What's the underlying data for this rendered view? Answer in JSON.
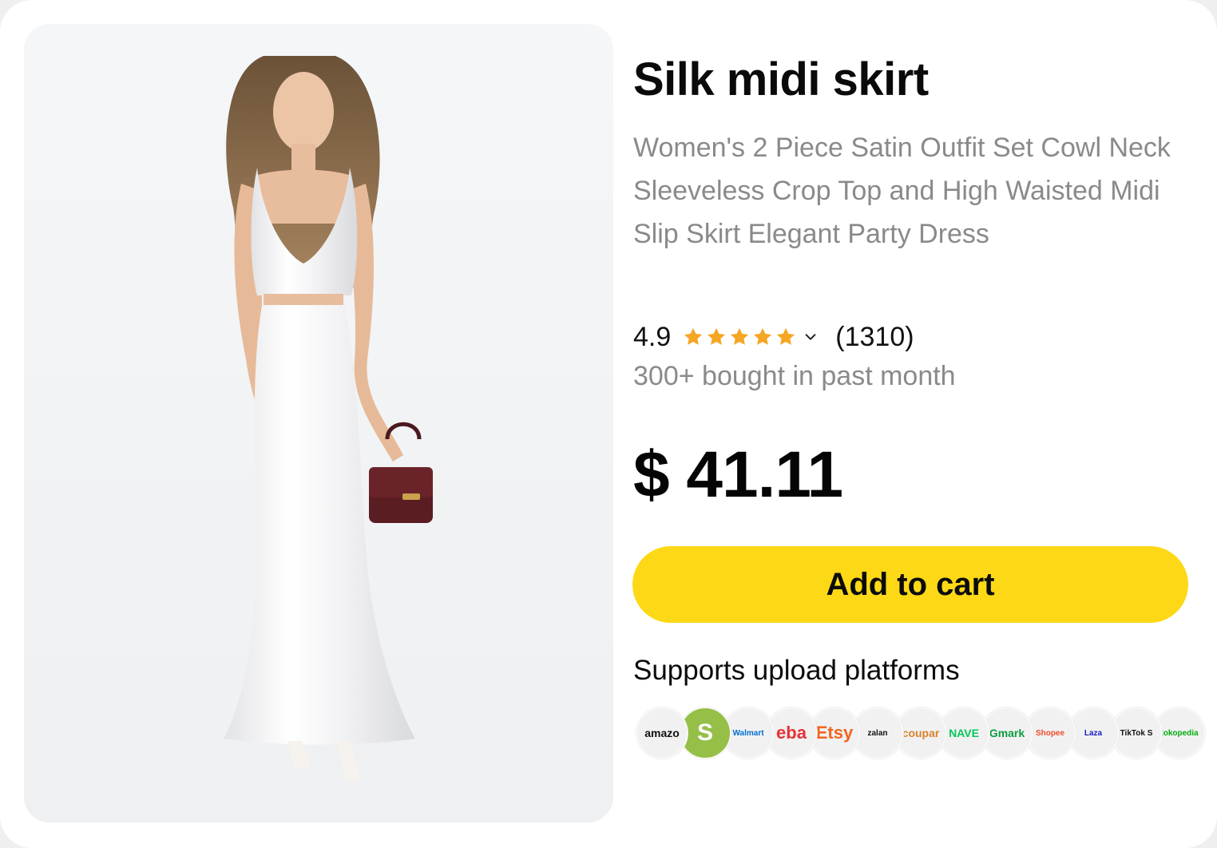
{
  "product": {
    "title": "Silk midi skirt",
    "description": "Women's 2 Piece Satin Outfit Set Cowl Neck Sleeveless Crop Top and High Waisted Midi Slip Skirt Elegant Party Dress",
    "rating": "4.9",
    "rating_value": 4.9,
    "review_count": "(1310)",
    "bought_text": "300+ bought in past month",
    "price": "$ 41.11"
  },
  "cart_button": {
    "label": "Add to cart"
  },
  "platforms": {
    "label": "Supports upload platforms",
    "items": [
      {
        "name": "amazon",
        "text": "amazo",
        "color": "#111111"
      },
      {
        "name": "shopify",
        "text": "S",
        "color": "#ffffff"
      },
      {
        "name": "walmart",
        "text": "Walmart",
        "color": "#0071ce"
      },
      {
        "name": "ebay",
        "text": "eba",
        "color": "#e53238"
      },
      {
        "name": "etsy",
        "text": "Etsy",
        "color": "#f1641e"
      },
      {
        "name": "zalando",
        "text": "zalan",
        "color": "#111111"
      },
      {
        "name": "coupang",
        "text": "coupar",
        "color": "#d9822b"
      },
      {
        "name": "naver",
        "text": "NAVE",
        "color": "#03c75a"
      },
      {
        "name": "gmarket",
        "text": "Gmark",
        "color": "#0a9e3f"
      },
      {
        "name": "shopee",
        "text": "Shopee",
        "color": "#ee4d2d"
      },
      {
        "name": "lazada",
        "text": "Laza",
        "color": "#1a1acb"
      },
      {
        "name": "tiktok-shop",
        "text": "TikTok S",
        "color": "#111111"
      },
      {
        "name": "tokopedia",
        "text": "tokopedia",
        "color": "#03ac0e"
      }
    ]
  },
  "colors": {
    "accent": "#fdd816",
    "star": "#f5a623",
    "muted_text": "#8a8a8a"
  }
}
